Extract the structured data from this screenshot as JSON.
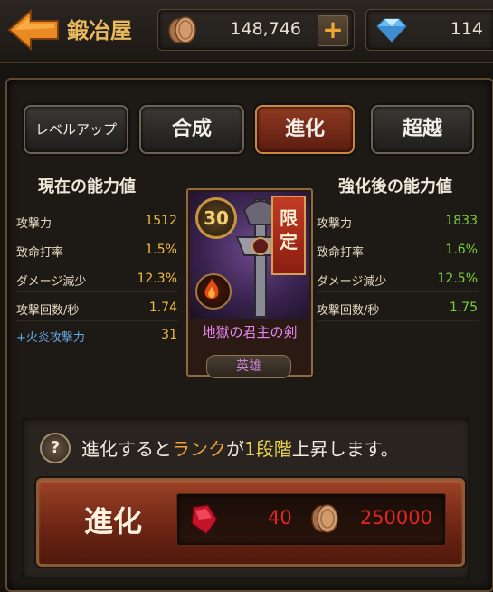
{
  "header": {
    "title": "鍛冶屋",
    "coins": "148,746",
    "plus_label": "+",
    "gems": "114"
  },
  "tabs": [
    {
      "label": "レベルアップ",
      "active": false
    },
    {
      "label": "合成",
      "active": false
    },
    {
      "label": "進化",
      "active": true
    },
    {
      "label": "超越",
      "active": false
    }
  ],
  "current_stats": {
    "title": "現在の能力値",
    "rows": [
      {
        "label": "攻撃力",
        "value": "1512"
      },
      {
        "label": "致命打率",
        "value": "1.5%"
      },
      {
        "label": "ダメージ減少",
        "value": "12.3%"
      },
      {
        "label": "攻撃回数/秒",
        "value": "1.74"
      },
      {
        "label": "+火炎攻撃力",
        "value": "31"
      }
    ]
  },
  "enhanced_stats": {
    "title": "強化後の能力値",
    "rows": [
      {
        "label": "攻撃力",
        "value": "1833"
      },
      {
        "label": "致命打率",
        "value": "1.6%"
      },
      {
        "label": "ダメージ減少",
        "value": "12.5%"
      },
      {
        "label": "攻撃回数/秒",
        "value": "1.75"
      }
    ]
  },
  "item": {
    "level": "30",
    "limited_line1": "限",
    "limited_line2": "定",
    "name": "地獄の君主の剣",
    "rarity": "英雄"
  },
  "info": {
    "part1": "進化すると",
    "part2": "ランク",
    "part3": "が",
    "part4": "1段階",
    "part5": "上昇します。"
  },
  "evolve_button": {
    "label": "進化",
    "ruby_cost": "40",
    "coin_cost": "250000"
  },
  "colors": {
    "accent_orange": "#f0a03b",
    "current_value": "#f0bd3e",
    "enhanced_value": "#7ccf3b",
    "cost_red": "#e0261f",
    "item_name": "#e686ef"
  }
}
